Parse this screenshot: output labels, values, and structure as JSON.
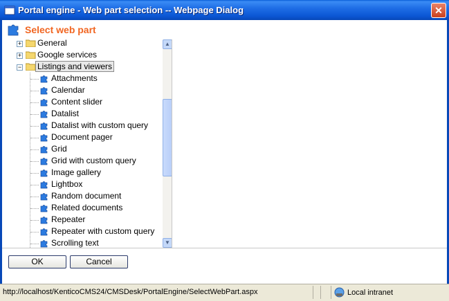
{
  "window": {
    "title": "Portal engine - Web part selection -- Webpage Dialog",
    "close_glyph": "✕"
  },
  "header": {
    "title": "Select web part"
  },
  "tree": {
    "categories": [
      {
        "label": "General",
        "expander": "+"
      },
      {
        "label": "Google services",
        "expander": "+"
      },
      {
        "label": "Listings and viewers",
        "expander": "−"
      }
    ],
    "items": [
      "Attachments",
      "Calendar",
      "Content slider",
      "Datalist",
      "Datalist with custom query",
      "Document pager",
      "Grid",
      "Grid with custom query",
      "Image gallery",
      "Lightbox",
      "Random document",
      "Related documents",
      "Repeater",
      "Repeater with custom query",
      "Scrolling text"
    ]
  },
  "buttons": {
    "ok": "OK",
    "cancel": "Cancel"
  },
  "statusbar": {
    "url": "http://localhost/KenticoCMS24/CMSDesk/PortalEngine/SelectWebPart.aspx",
    "zone": "Local intranet"
  },
  "colors": {
    "title_bar": "#0b56d4",
    "header_text": "#f16622",
    "frame": "#0848b8"
  },
  "scrollbar": {
    "up_glyph": "▲",
    "down_glyph": "▼"
  }
}
